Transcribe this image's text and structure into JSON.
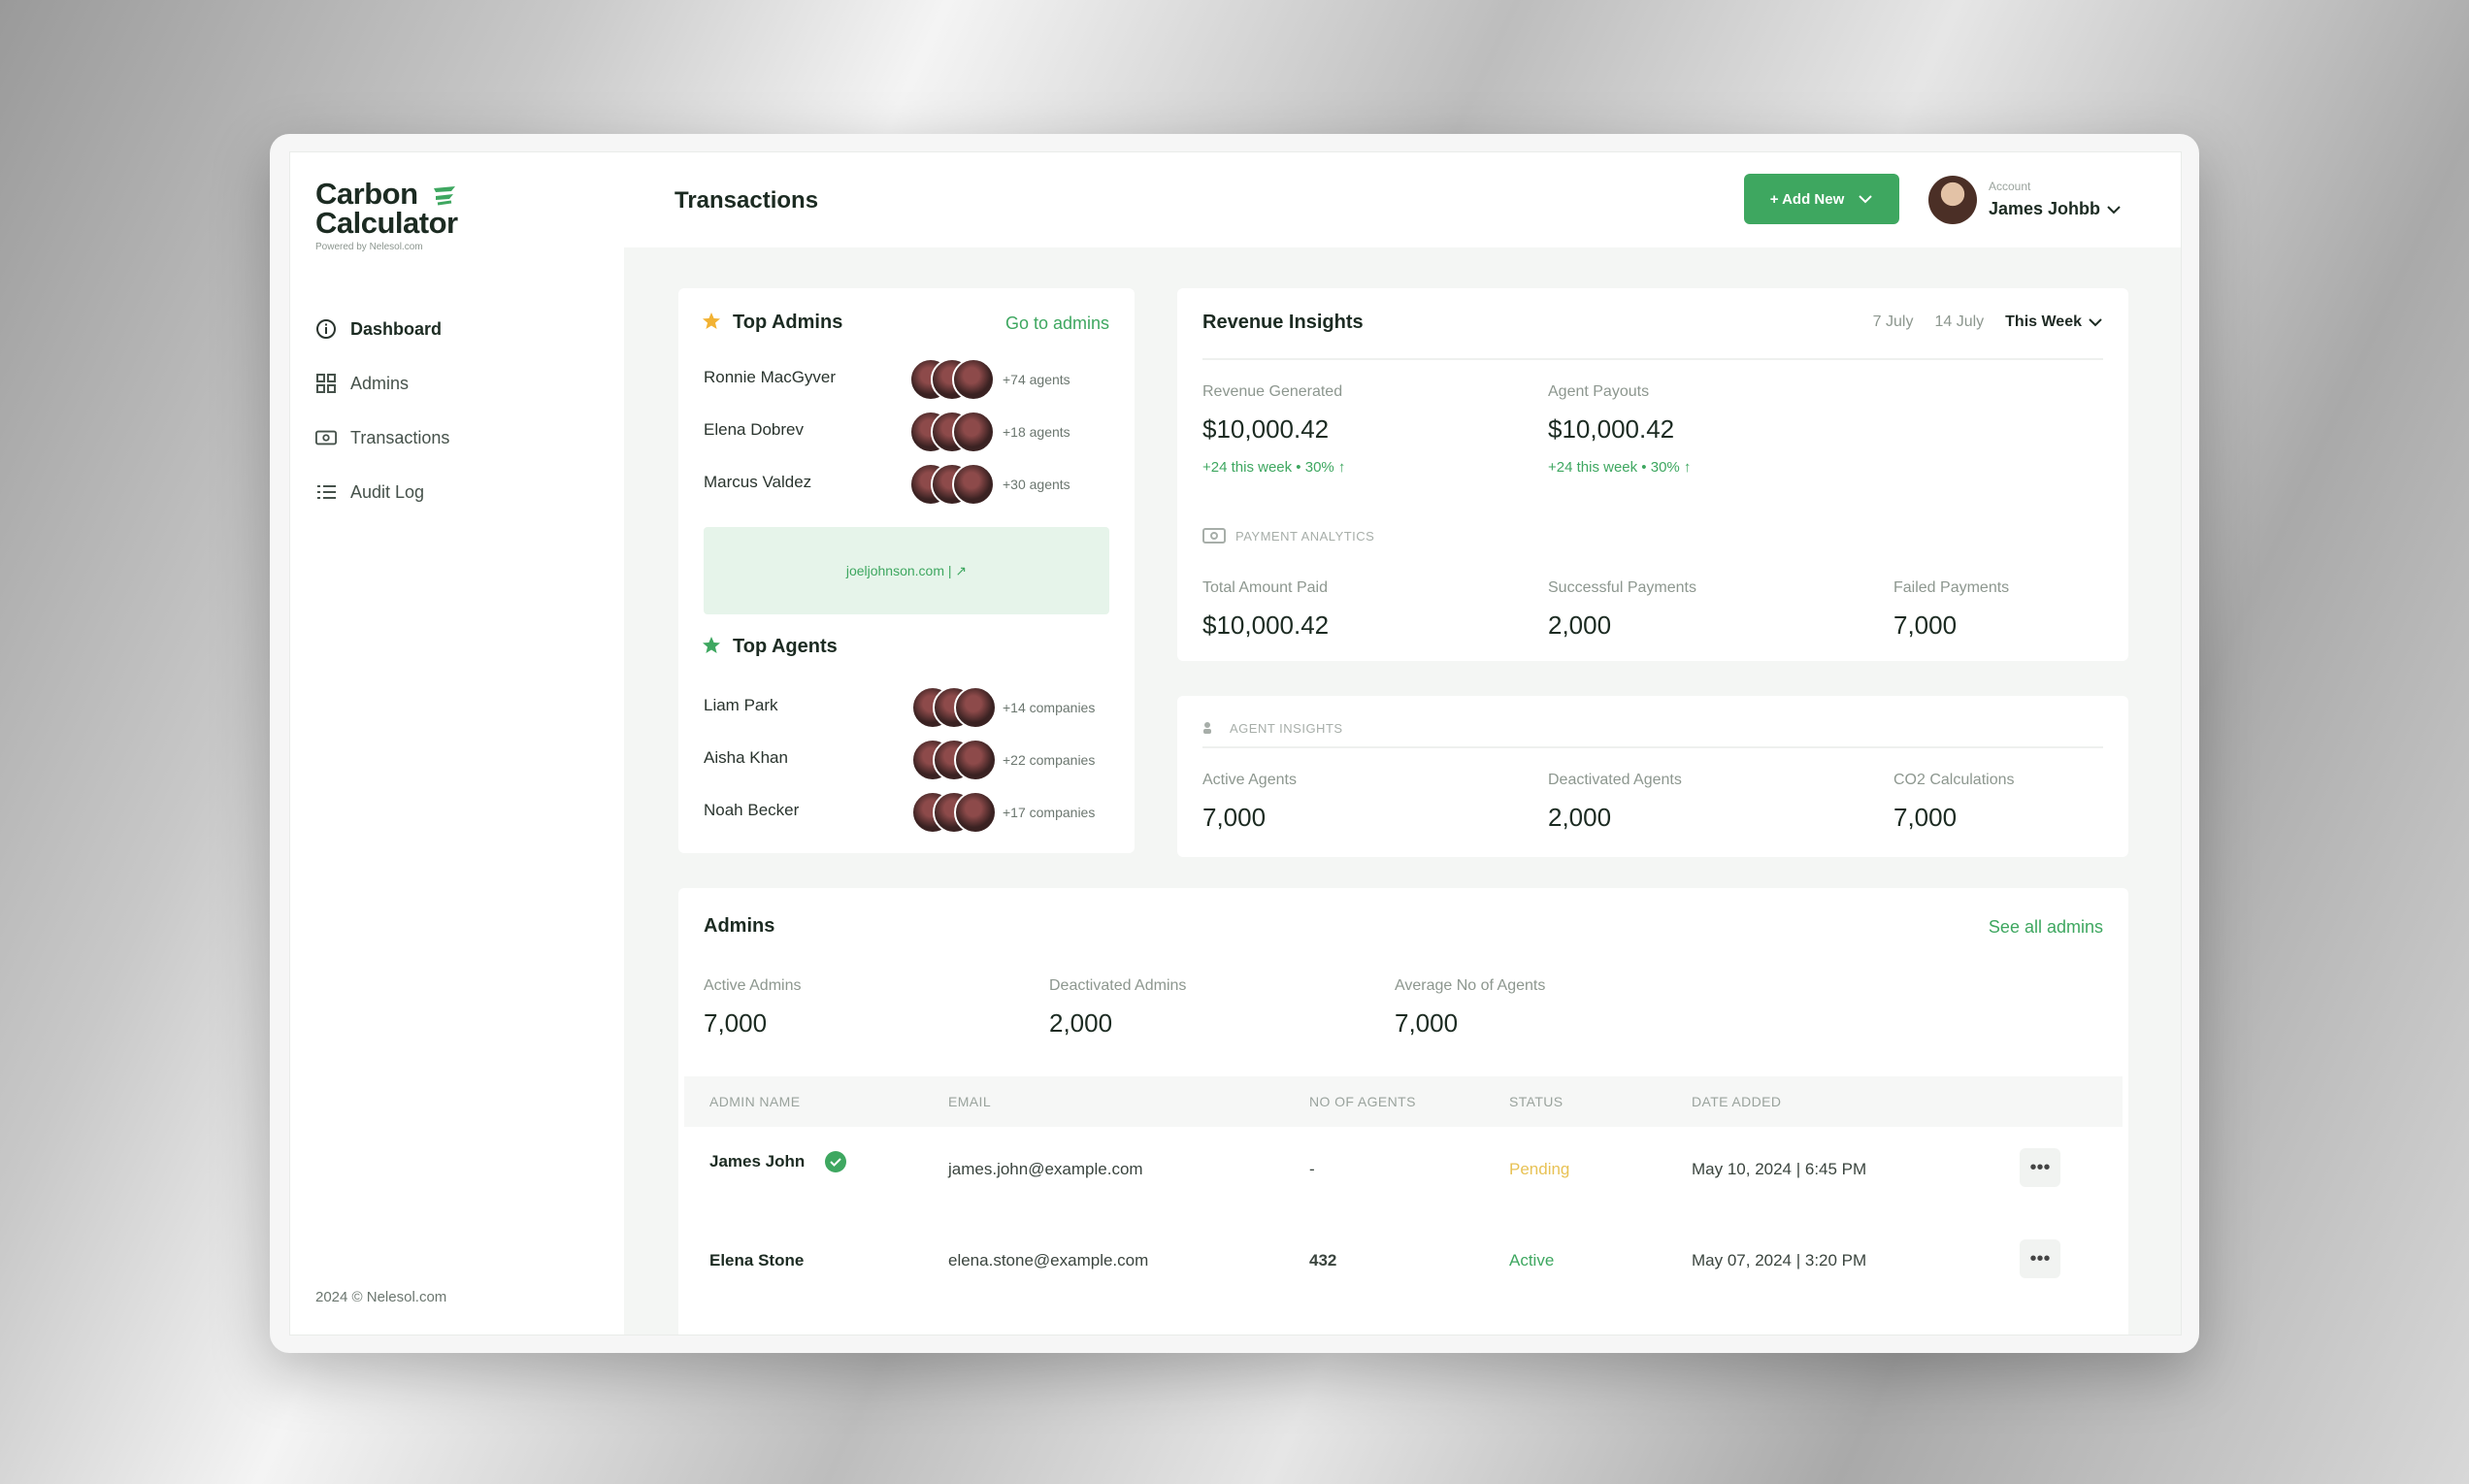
{
  "brand": {
    "line1": "Carbon",
    "line2": "Calculator",
    "sub": "Powered by Nelesol.com"
  },
  "nav": [
    {
      "label": "Dashboard",
      "icon": "info-icon",
      "active": true
    },
    {
      "label": "Admins",
      "icon": "grid-icon",
      "active": false
    },
    {
      "label": "Transactions",
      "icon": "money-icon",
      "active": false
    },
    {
      "label": "Audit Log",
      "icon": "list-icon",
      "active": false
    }
  ],
  "footer": "2024 © Nelesol.com",
  "header": {
    "title": "Transactions",
    "add_label": "+ Add New",
    "account_label": "Account",
    "account_name": "James Johbb"
  },
  "top_admins": {
    "title": "Top Admins",
    "link": "Go to admins",
    "rows": [
      {
        "name": "Ronnie MacGyver",
        "count": "+74 agents"
      },
      {
        "name": "Elena Dobrev",
        "count": "+18 agents"
      },
      {
        "name": "Marcus Valdez",
        "count": "+30 agents"
      }
    ],
    "site": "joeljohnson.com | ↗"
  },
  "top_agents": {
    "title": "Top Agents",
    "rows": [
      {
        "name": "Liam Park",
        "count": "+14 companies"
      },
      {
        "name": "Aisha Khan",
        "count": "+22 companies"
      },
      {
        "name": "Noah Becker",
        "count": "+17 companies"
      }
    ]
  },
  "revenue": {
    "title": "Revenue Insights",
    "filters": [
      "7 July",
      "14 July",
      "This Week"
    ],
    "generated_label": "Revenue Generated",
    "generated_value": "$10,000.42",
    "generated_note": "+24 this week • 30% ↑",
    "payouts_label": "Agent Payouts",
    "payouts_value": "$10,000.42",
    "payouts_note": "+24 this week • 30% ↑",
    "payment_section": "PAYMENT ANALYTICS",
    "total_label": "Total Amount Paid",
    "total_value": "$10,000.42",
    "success_label": "Successful Payments",
    "success_value": "2,000",
    "failed_label": "Failed Payments",
    "failed_value": "7,000"
  },
  "agent_insights": {
    "section": "AGENT INSIGHTS",
    "active_label": "Active Agents",
    "active_value": "7,000",
    "deact_label": "Deactivated Agents",
    "deact_value": "2,000",
    "co2_label": "CO2 Calculations",
    "co2_value": "7,000"
  },
  "admins": {
    "title": "Admins",
    "link": "See all admins",
    "active_label": "Active Admins",
    "active_value": "7,000",
    "deact_label": "Deactivated Admins",
    "deact_value": "2,000",
    "avg_label": "Average No of Agents",
    "avg_value": "7,000",
    "columns": [
      "ADMIN NAME",
      "EMAIL",
      "NO OF AGENTS",
      "STATUS",
      "DATE ADDED"
    ],
    "rows": [
      {
        "name": "James John",
        "email": "james.john@example.com",
        "agents": "-",
        "status": "Pending",
        "date": "May 10, 2024 | 6:45 PM"
      },
      {
        "name": "Elena Stone",
        "email": "elena.stone@example.com",
        "agents": "432",
        "status": "Active",
        "date": "May 07, 2024 | 3:20 PM"
      }
    ]
  },
  "colors": {
    "accent": "#3ea760",
    "pending": "#e8c255",
    "text": "#1c2b22"
  }
}
